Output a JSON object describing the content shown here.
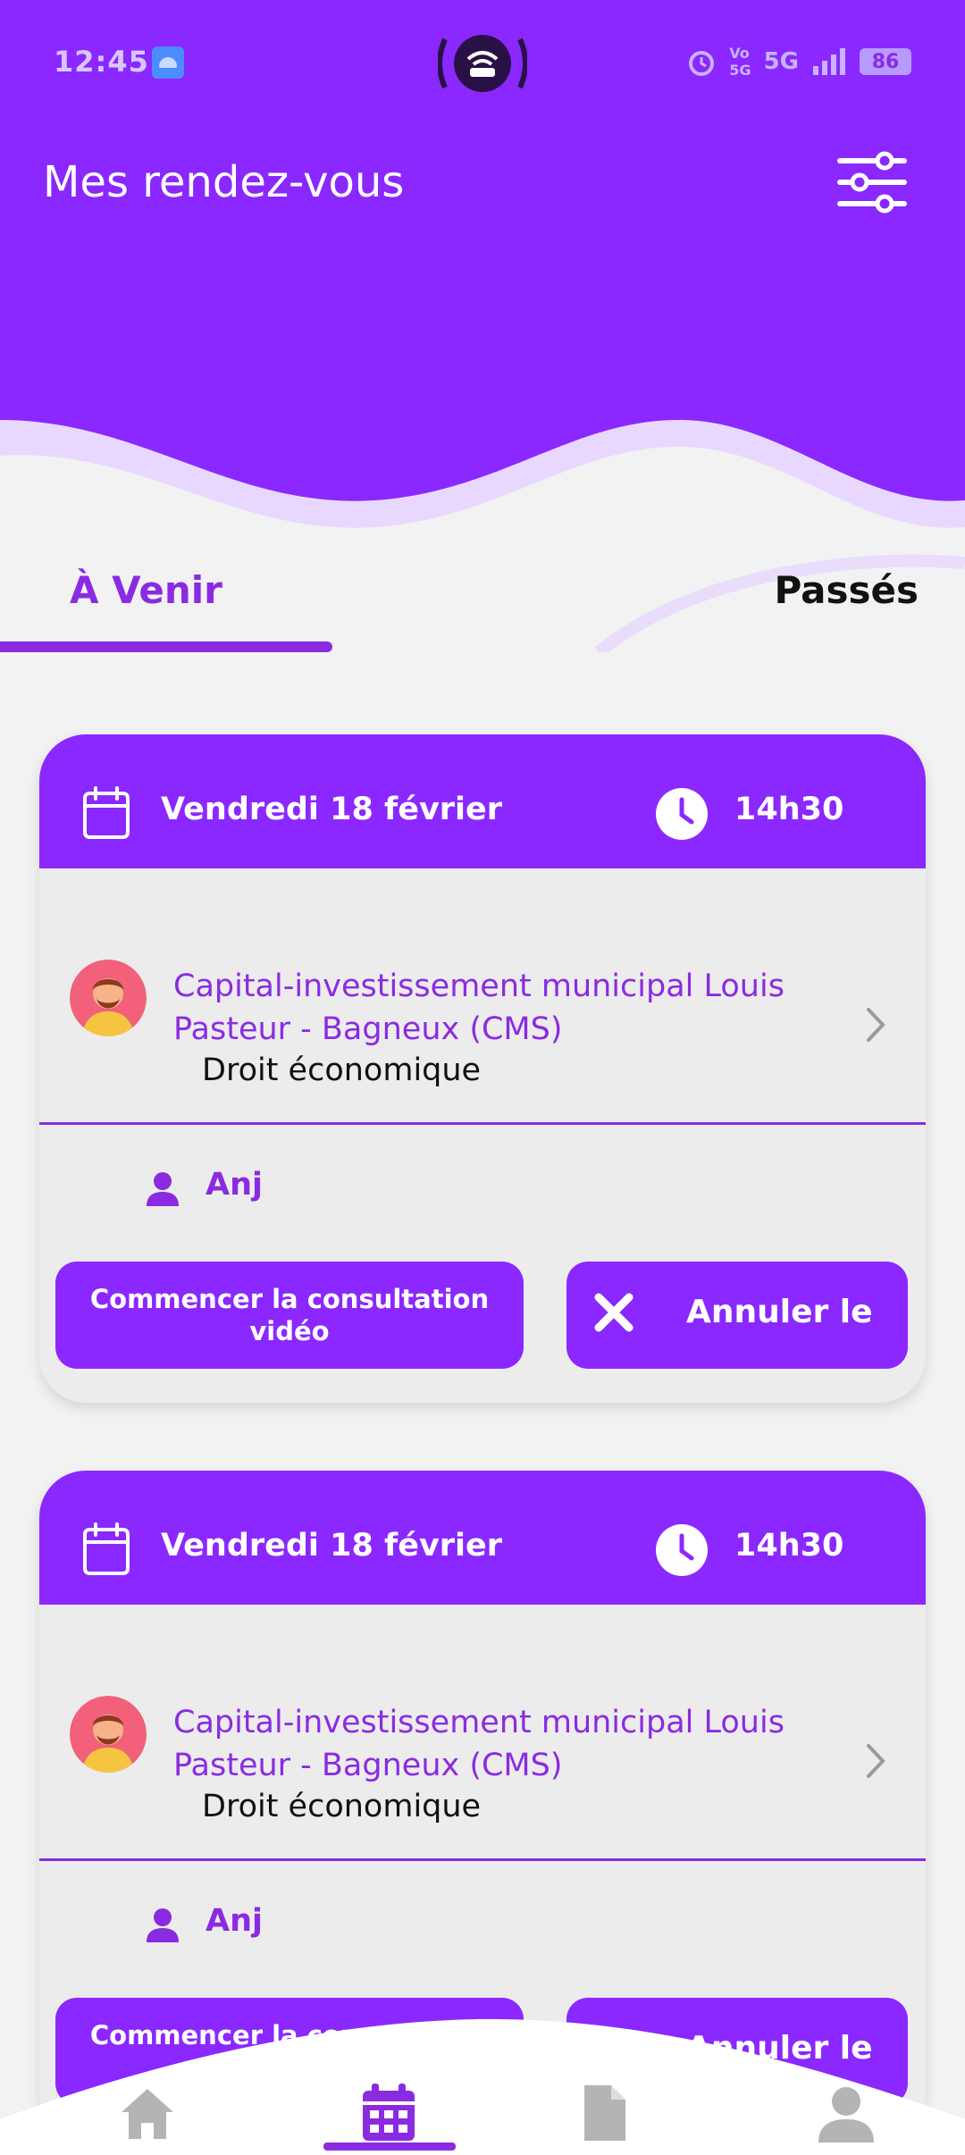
{
  "status_bar": {
    "time": "12:45",
    "network": "5G",
    "battery": "86"
  },
  "header": {
    "title": "Mes rendez-vous",
    "filter_icon": "sliders-icon"
  },
  "tabs": {
    "upcoming": "À Venir",
    "past": "Passés",
    "active": "upcoming"
  },
  "appointments": [
    {
      "date": "Vendredi 18 février",
      "time": "14h30",
      "organization": "Capital-investissement municipal Louis Pasteur - Bagneux (CMS)",
      "specialty": "Droit économique",
      "patient": "Anj",
      "video_button": "Commencer la consultation vidéo",
      "cancel_button": "Annuler le"
    },
    {
      "date": "Vendredi 18 février",
      "time": "14h30",
      "organization": "Capital-investissement municipal Louis Pasteur - Bagneux (CMS)",
      "specialty": "Droit économique",
      "patient": "Anj",
      "video_button": "Commencer la consultation vidéo",
      "cancel_button": "Annuler le"
    }
  ],
  "bottom_nav": {
    "items": [
      "home-icon",
      "calendar-icon",
      "document-icon",
      "profile-icon"
    ],
    "active": "calendar-icon"
  },
  "colors": {
    "primary": "#8a28ff",
    "accent_text": "#8a2be2",
    "background": "#f2f2f2"
  }
}
